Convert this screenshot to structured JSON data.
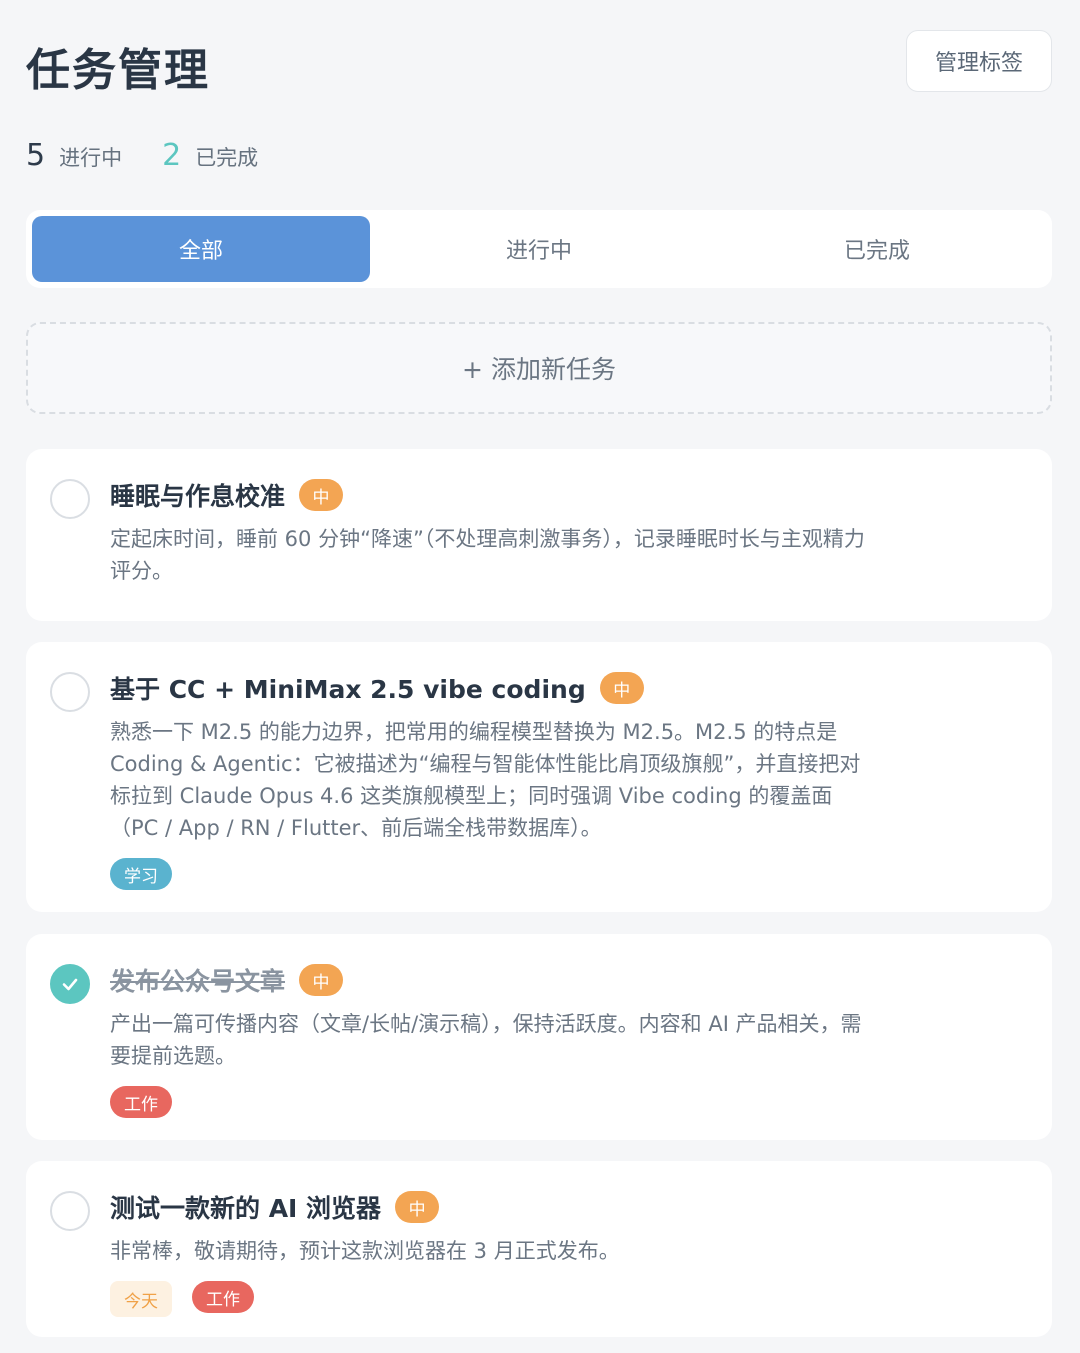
{
  "header": {
    "title": "任务管理",
    "manage_tags_label": "管理标签"
  },
  "stats": {
    "active_count": "5",
    "active_label": "进行中",
    "done_count": "2",
    "done_label": "已完成"
  },
  "tabs": [
    {
      "label": "全部",
      "selected": true
    },
    {
      "label": "进行中",
      "selected": false
    },
    {
      "label": "已完成",
      "selected": false
    }
  ],
  "add_task_label": "+ 添加新任务",
  "tasks": [
    {
      "title": "睡眠与作息校准",
      "priority": "中",
      "completed": false,
      "description": "定起床时间，睡前 60 分钟“降速”（不处理高刺激事务），记录睡眠时长与主观精力评分。",
      "tags": []
    },
    {
      "title": "基于 CC + MiniMax 2.5 vibe coding",
      "priority": "中",
      "completed": false,
      "description": "熟悉一下 M2.5 的能力边界，把常用的编程模型替换为 M2.5。M2.5 的特点是 Coding & Agentic：它被描述为“编程与智能体性能比肩顶级旗舰”，并直接把对标拉到 Claude Opus 4.6 这类旗舰模型上；同时强调 Vibe coding 的覆盖面（PC / App / RN / Flutter、前后端全栈带数据库）。",
      "tags": [
        "学习"
      ]
    },
    {
      "title": "发布公众号文章",
      "priority": "中",
      "completed": true,
      "description": "产出一篇可传播内容（文章/长帖/演示稿），保持活跃度。内容和 AI 产品相关，需要提前选题。",
      "tags": [
        "工作"
      ]
    },
    {
      "title": "测试一款新的 AI 浏览器",
      "priority": "中",
      "completed": false,
      "description": "非常棒，敬请期待，预计这款浏览器在 3 月正式发布。",
      "tags": [
        "今天",
        "工作"
      ]
    }
  ],
  "colors": {
    "accent": "#5b93d9",
    "done": "#5cc6c0",
    "priority": "#f3a553",
    "tag_study": "#5ab3cf",
    "tag_work": "#e8675f",
    "tag_today_bg": "#fdf1e1"
  },
  "icons": {
    "checked": "check-icon",
    "unchecked": "empty-circle-icon"
  }
}
